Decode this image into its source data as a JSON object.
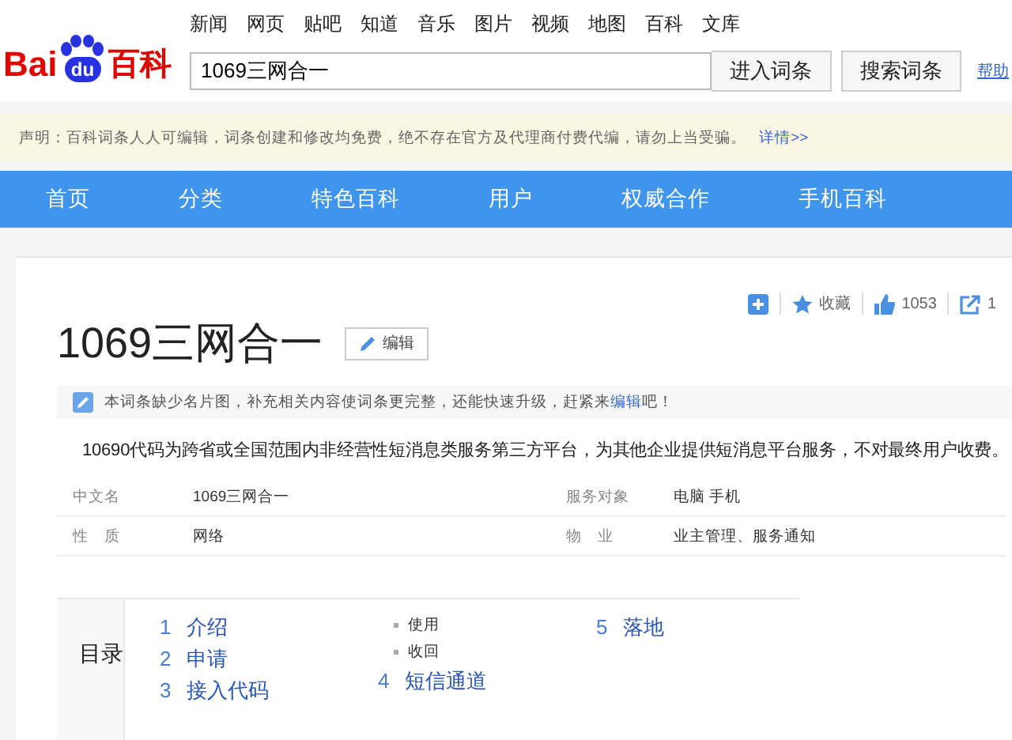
{
  "logo": {
    "lead": "Bai",
    "paw": "du",
    "suffix": "百科"
  },
  "top_links": [
    "新闻",
    "网页",
    "贴吧",
    "知道",
    "音乐",
    "图片",
    "视频",
    "地图",
    "百科",
    "文库"
  ],
  "search": {
    "value": "1069三网合一"
  },
  "search_buttons": [
    "进入词条",
    "搜索词条"
  ],
  "help_link": "帮助",
  "notice": {
    "text": "声明：百科词条人人可编辑，词条创建和修改均免费，绝不存在官方及代理商付费代编，请勿上当受骗。",
    "link": "详情>>"
  },
  "main_nav": [
    "首页",
    "分类",
    "特色百科",
    "用户",
    "权威合作",
    "手机百科"
  ],
  "article": {
    "title": "1069三网合一",
    "edit_button": "编辑",
    "actions": [
      {
        "kind": "add"
      },
      {
        "kind": "favorite",
        "label": "收藏"
      },
      {
        "kind": "like",
        "label": "1053"
      },
      {
        "kind": "share",
        "label": "1"
      }
    ],
    "hint": {
      "before": "本词条缺少名片图，补充相关内容使词条更完整，还能快速升级，赶紧来",
      "link": "编辑",
      "after": "吧！"
    },
    "summary": "10690代码为跨省或全国范围内非经营性短消息类服务第三方平台，为其他企业提供短消息平台服务，不对最终用户收费。",
    "infobox": [
      {
        "label": "中文名",
        "value": "1069三网合一"
      },
      {
        "label": "服务对象",
        "value": "电脑 手机"
      },
      {
        "label": "性　质",
        "value": "网络"
      },
      {
        "label": "物　业",
        "value": "业主管理、服务通知"
      }
    ],
    "toc": {
      "title": "目录",
      "columns": [
        [
          {
            "kind": "level1",
            "num": "1",
            "label": "介绍"
          },
          {
            "kind": "level1",
            "num": "2",
            "label": "申请"
          },
          {
            "kind": "level1",
            "num": "3",
            "label": "接入代码"
          }
        ],
        [
          {
            "kind": "level2",
            "label": "使用"
          },
          {
            "kind": "level2",
            "label": "收回"
          },
          {
            "kind": "level1",
            "num": "4",
            "label": "短信通道"
          }
        ],
        [
          {
            "kind": "level1",
            "num": "5",
            "label": "落地"
          }
        ]
      ]
    }
  }
}
